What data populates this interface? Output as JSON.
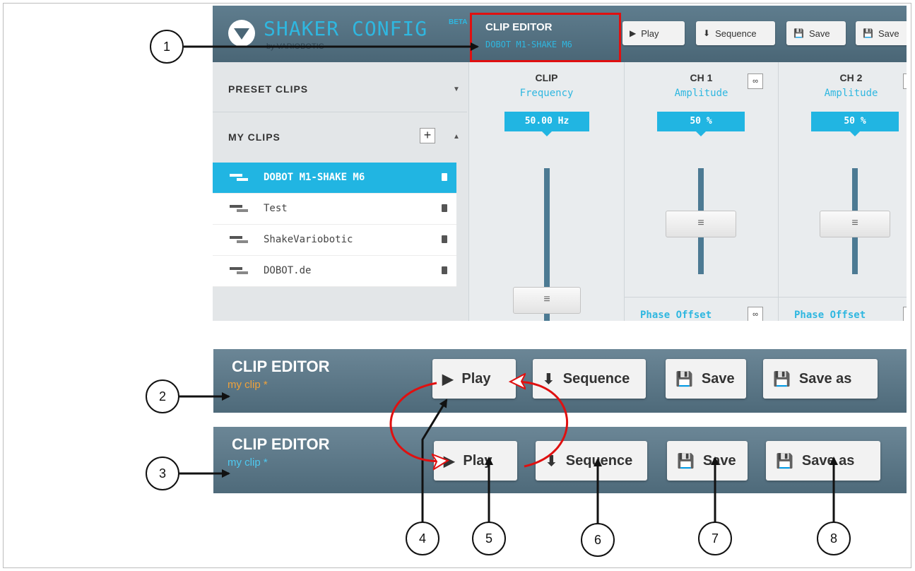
{
  "top_screenshot": {
    "brand": "SHAKER CONFIG",
    "beta": "BETA",
    "brand_sub": "by VARIOBOTIC",
    "clip_editor_title": "CLIP EDITOR",
    "clip_editor_sub": "DOBOT M1-SHAKE M6",
    "toolbar": {
      "play": "Play",
      "sequence": "Sequence",
      "save": "Save",
      "save_as": "Save"
    },
    "sidebar": {
      "preset_clips": "PRESET CLIPS",
      "my_clips": "MY CLIPS",
      "clips": [
        "DOBOT M1-SHAKE M6",
        "Test",
        "ShakeVariobotic",
        "DOBOT.de"
      ]
    },
    "clip_column": {
      "title": "CLIP",
      "sub": "Frequency",
      "value": "50.00 Hz"
    },
    "ch1_column": {
      "title": "CH 1",
      "sub": "Amplitude",
      "value": "50 %",
      "phase": "Phase Offset"
    },
    "ch2_column": {
      "title": "CH 2",
      "sub": "Amplitude",
      "value": "50 %",
      "phase": "Phase Offset"
    }
  },
  "bar_orange": {
    "title": "CLIP EDITOR",
    "sub": "my clip *",
    "sub_color": "#f0a23a",
    "buttons": {
      "play": "Play",
      "sequence": "Sequence",
      "save": "Save",
      "save_as": "Save as"
    }
  },
  "bar_blue": {
    "title": "CLIP EDITOR",
    "sub": "my clip *",
    "sub_color": "#4ec9f0",
    "buttons": {
      "play": "Play",
      "sequence": "Sequence",
      "save": "Save",
      "save_as": "Save as"
    }
  },
  "callouts": [
    "1",
    "2",
    "3",
    "4",
    "5",
    "6",
    "7",
    "8"
  ],
  "colors": {
    "accent": "#21b5e2",
    "highlight_box": "#e01010",
    "arrow": "#e01010"
  }
}
